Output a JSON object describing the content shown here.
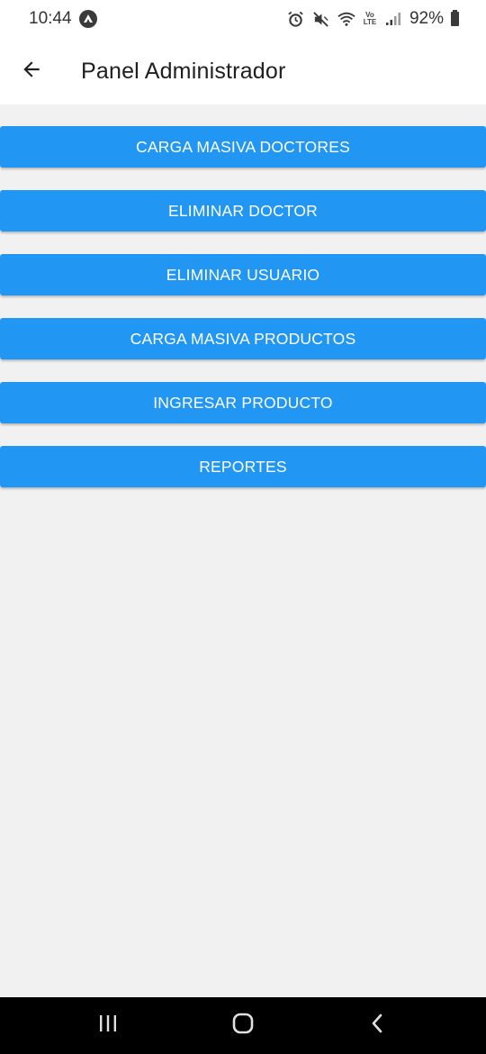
{
  "status_bar": {
    "time": "10:44",
    "battery": "92%",
    "lte_top": "Vo",
    "lte_bottom": "LTE"
  },
  "app_bar": {
    "title": "Panel Administrador"
  },
  "menu": {
    "buttons": [
      {
        "label": "CARGA MASIVA DOCTORES"
      },
      {
        "label": "ELIMINAR DOCTOR"
      },
      {
        "label": "ELIMINAR USUARIO"
      },
      {
        "label": "CARGA MASIVA PRODUCTOS"
      },
      {
        "label": "INGRESAR PRODUCTO"
      },
      {
        "label": "REPORTES"
      }
    ]
  },
  "colors": {
    "accent": "#2196f3",
    "background": "#f1f1f1",
    "app_bar": "#ffffff",
    "nav_bar": "#000000"
  },
  "icons": {
    "back": "arrow-left-icon",
    "alarm": "alarm-icon",
    "mute": "muted-speaker-icon",
    "wifi": "wifi-icon",
    "signal": "signal-icon",
    "battery": "battery-icon",
    "recents": "recents-icon",
    "home": "home-icon",
    "nav_back": "chevron-left-icon"
  }
}
